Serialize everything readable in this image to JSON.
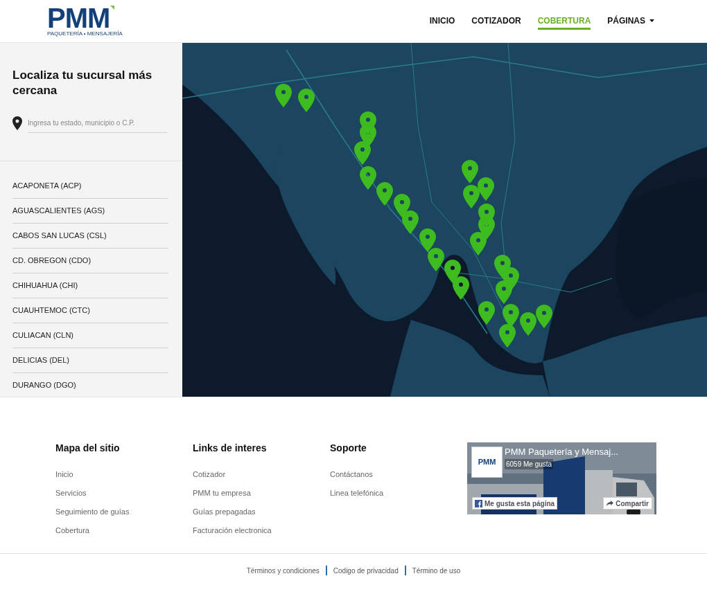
{
  "logo": {
    "wordmark": "PMM",
    "tagline": "PAQUETERÍA • MENSAJERÍA"
  },
  "nav": [
    {
      "label": "INICIO",
      "selected": false,
      "dropdown": false
    },
    {
      "label": "COTIZADOR",
      "selected": false,
      "dropdown": false
    },
    {
      "label": "COBERTURA",
      "selected": true,
      "dropdown": false
    },
    {
      "label": "PÁGINAS",
      "selected": false,
      "dropdown": true
    }
  ],
  "locator": {
    "title": "Localiza tu sucursal más cercana",
    "search": {
      "placeholder": "Ingresa tu estado, municipio o C.P."
    }
  },
  "branches": [
    "ACAPONETA (ACP)",
    "AGUASCALIENTES (AGS)",
    "CABOS SAN LUCAS (CSL)",
    "CD. OBREGON (CDO)",
    "CHIHUAHUA (CHI)",
    "CUAUHTEMOC (CTC)",
    "CULIACAN (CLN)",
    "DELICIAS (DEL)",
    "DURANGO (DGO)"
  ],
  "footer_columns": [
    {
      "heading": "Mapa del sitio",
      "links": [
        "Inicio",
        "Servicios",
        "Seguimiento de guías",
        "Cobertura"
      ]
    },
    {
      "heading": "Links de interes",
      "links": [
        "Cotizador",
        "PMM tu empresa",
        "Guías prepagadas",
        "Facturación electronica"
      ]
    },
    {
      "heading": "Soporte",
      "links": [
        "Contáctanos",
        "Linea telefónica"
      ]
    }
  ],
  "facebook_widget": {
    "page_name": "PMM Paquetería y Mensaj...",
    "likes": "6059 Me gusta",
    "logo": "PMM",
    "like_button": "Me gusta esta página",
    "share_button": "Compartir"
  },
  "legal_links": [
    "Términos y condiciones",
    "Codigo de privacidad",
    "Término de uso"
  ]
}
